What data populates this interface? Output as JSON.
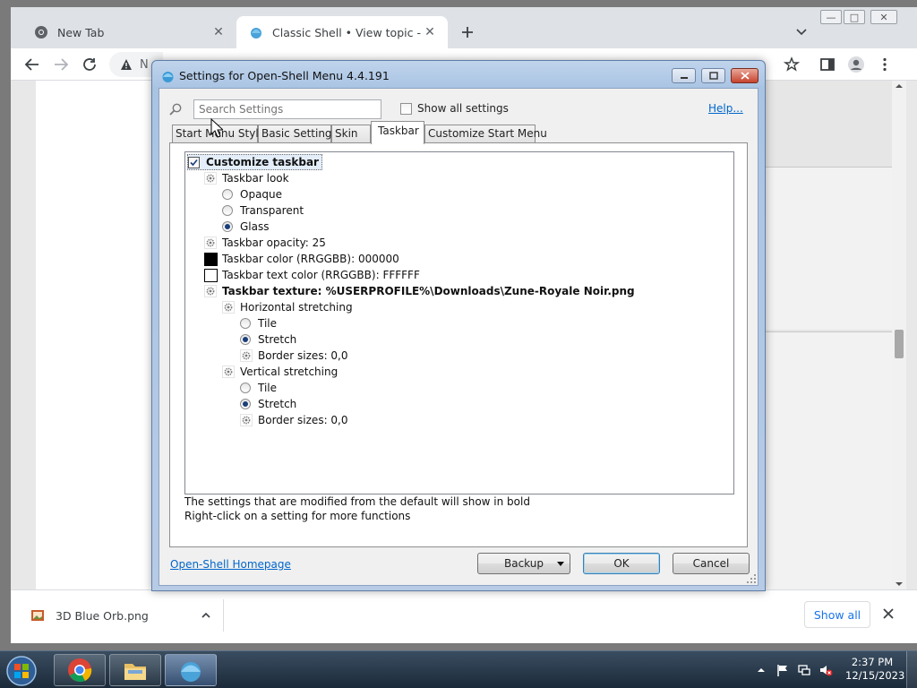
{
  "browser": {
    "tabs": [
      {
        "title": "New Tab",
        "active": false
      },
      {
        "title": "Classic Shell • View topic - Start M",
        "active": true
      }
    ],
    "address_text": "N",
    "download": {
      "file": "3D Blue Orb.png",
      "show_all": "Show all"
    }
  },
  "dialog": {
    "title": "Settings for Open-Shell Menu 4.4.191",
    "search_placeholder": "Search Settings",
    "show_all_settings": "Show all settings",
    "help": "Help...",
    "tabs": [
      {
        "label": "Start Menu Style",
        "active": false
      },
      {
        "label": "Basic Settings",
        "active": false
      },
      {
        "label": "Skin",
        "active": false
      },
      {
        "label": "Taskbar",
        "active": true
      },
      {
        "label": "Customize Start Menu",
        "active": false
      }
    ],
    "tree": [
      {
        "label": "Customize taskbar",
        "kind": "checkbox",
        "checked": true,
        "bold": true
      },
      {
        "label": "Taskbar look",
        "kind": "gear"
      },
      {
        "label": "Opaque",
        "kind": "radio",
        "selected": false
      },
      {
        "label": "Transparent",
        "kind": "radio",
        "selected": false
      },
      {
        "label": "Glass",
        "kind": "radio",
        "selected": true
      },
      {
        "label": "Taskbar opacity: 25",
        "kind": "gear"
      },
      {
        "label": "Taskbar color (RRGGBB): 000000",
        "kind": "swatch",
        "color": "#000000"
      },
      {
        "label": "Taskbar text color (RRGGBB): FFFFFF",
        "kind": "swatch",
        "color": "#FFFFFF"
      },
      {
        "label": "Taskbar texture: %USERPROFILE%\\Downloads\\Zune-Royale Noir.png",
        "kind": "gear",
        "bold": true
      },
      {
        "label": "Horizontal stretching",
        "kind": "gear"
      },
      {
        "label": "Tile",
        "kind": "radio",
        "selected": false
      },
      {
        "label": "Stretch",
        "kind": "radio",
        "selected": true
      },
      {
        "label": "Border sizes: 0,0",
        "kind": "gear"
      },
      {
        "label": "Vertical stretching",
        "kind": "gear"
      },
      {
        "label": "Tile",
        "kind": "radio",
        "selected": false
      },
      {
        "label": "Stretch",
        "kind": "radio",
        "selected": true
      },
      {
        "label": "Border sizes: 0,0",
        "kind": "gear"
      }
    ],
    "hint_line1": "The settings that are modified from the default will show in bold",
    "hint_line2": "Right-click on a setting for more functions",
    "homepage": "Open-Shell Homepage",
    "buttons": {
      "backup": "Backup",
      "ok": "OK",
      "cancel": "Cancel"
    }
  },
  "taskbar": {
    "time": "2:37 PM",
    "date": "12/15/2023"
  },
  "colors": {
    "link": "#0066cc",
    "chrome_blue": "#1a73e8",
    "selected_radio": "#1a3e7a"
  }
}
